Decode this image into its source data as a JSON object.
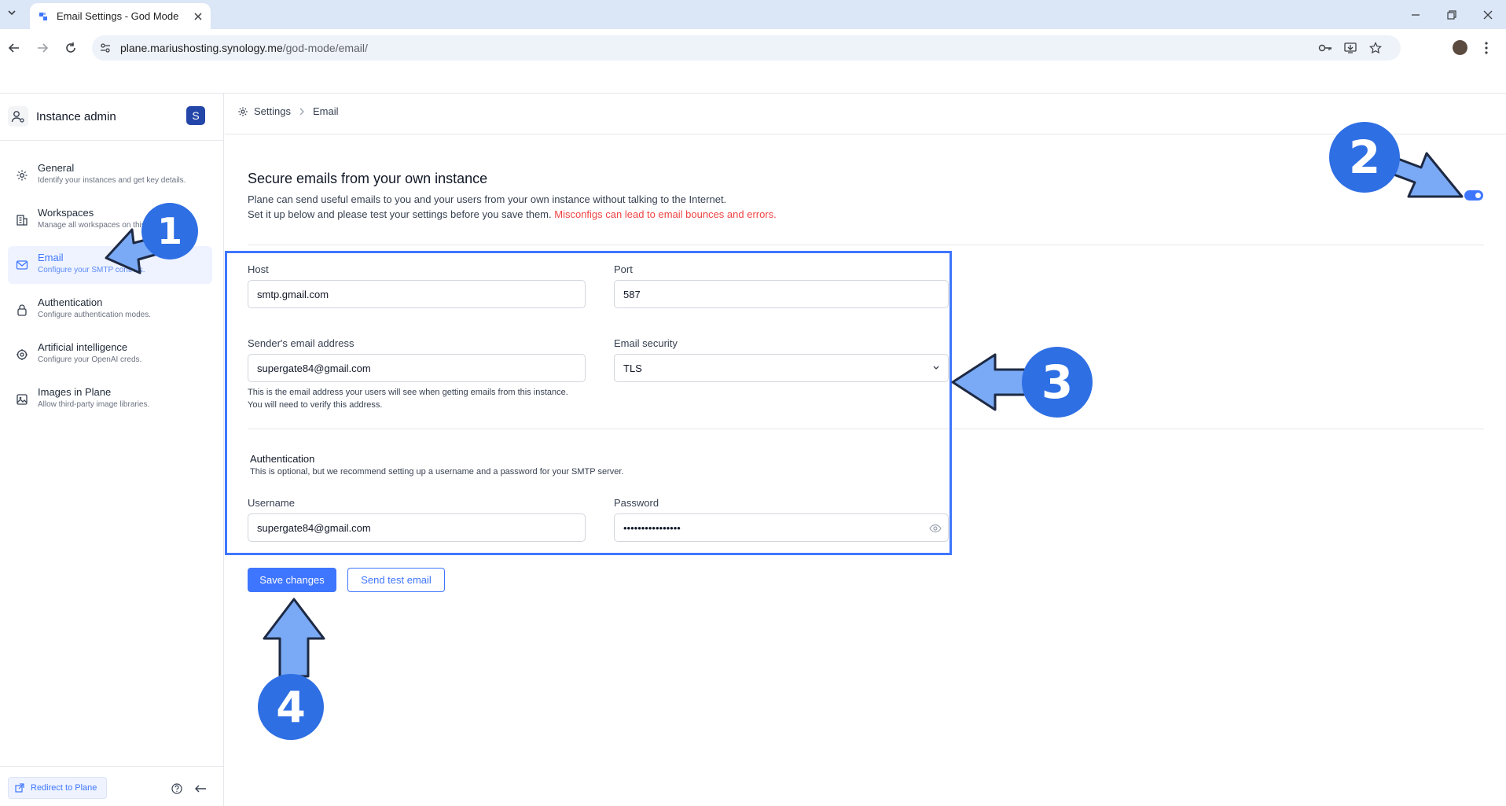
{
  "browser": {
    "tab_title": "Email Settings - God Mode",
    "url_host": "plane.mariushosting.synology.me",
    "url_path": "/god-mode/email/"
  },
  "sidebar": {
    "title": "Instance admin",
    "avatar_letter": "S",
    "items": [
      {
        "label": "General",
        "desc": "Identify your instances and get key details.",
        "icon": "gear-icon"
      },
      {
        "label": "Workspaces",
        "desc": "Manage all workspaces on this",
        "icon": "building-icon"
      },
      {
        "label": "Email",
        "desc": "Configure your SMTP controls.",
        "icon": "mail-icon"
      },
      {
        "label": "Authentication",
        "desc": "Configure authentication modes.",
        "icon": "lock-icon"
      },
      {
        "label": "Artificial intelligence",
        "desc": "Configure your OpenAI creds.",
        "icon": "brain-icon"
      },
      {
        "label": "Images in Plane",
        "desc": "Allow third-party image libraries.",
        "icon": "image-icon"
      }
    ],
    "redirect_label": "Redirect to Plane"
  },
  "breadcrumb": {
    "root": "Settings",
    "current": "Email"
  },
  "main": {
    "heading": "Secure emails from your own instance",
    "desc1": "Plane can send useful emails to you and your users from your own instance without talking to the Internet.",
    "desc2": "Set it up below and please test your settings before you save them.",
    "desc2_warn": "Misconfigs can lead to email bounces and errors.",
    "toggle_on": true
  },
  "form": {
    "host_label": "Host",
    "host_value": "smtp.gmail.com",
    "port_label": "Port",
    "port_value": "587",
    "sender_label": "Sender's email address",
    "sender_value": "supergate84@gmail.com",
    "sender_hint1": "This is the email address your users will see when getting emails from this instance.",
    "sender_hint2": "You will need to verify this address.",
    "security_label": "Email security",
    "security_value": "TLS",
    "auth_title": "Authentication",
    "auth_desc": "This is optional, but we recommend setting up a username and a password for your SMTP server.",
    "username_label": "Username",
    "username_value": "supergate84@gmail.com",
    "password_label": "Password",
    "password_value": "••••••••••••••••"
  },
  "actions": {
    "save": "Save changes",
    "test": "Send test email"
  },
  "callouts": [
    "1",
    "2",
    "3",
    "4"
  ],
  "colors": {
    "accent": "#3f76ff",
    "callout": "#2f6fe4",
    "arrow": "#7aaaf5",
    "warn": "#ef4444"
  }
}
